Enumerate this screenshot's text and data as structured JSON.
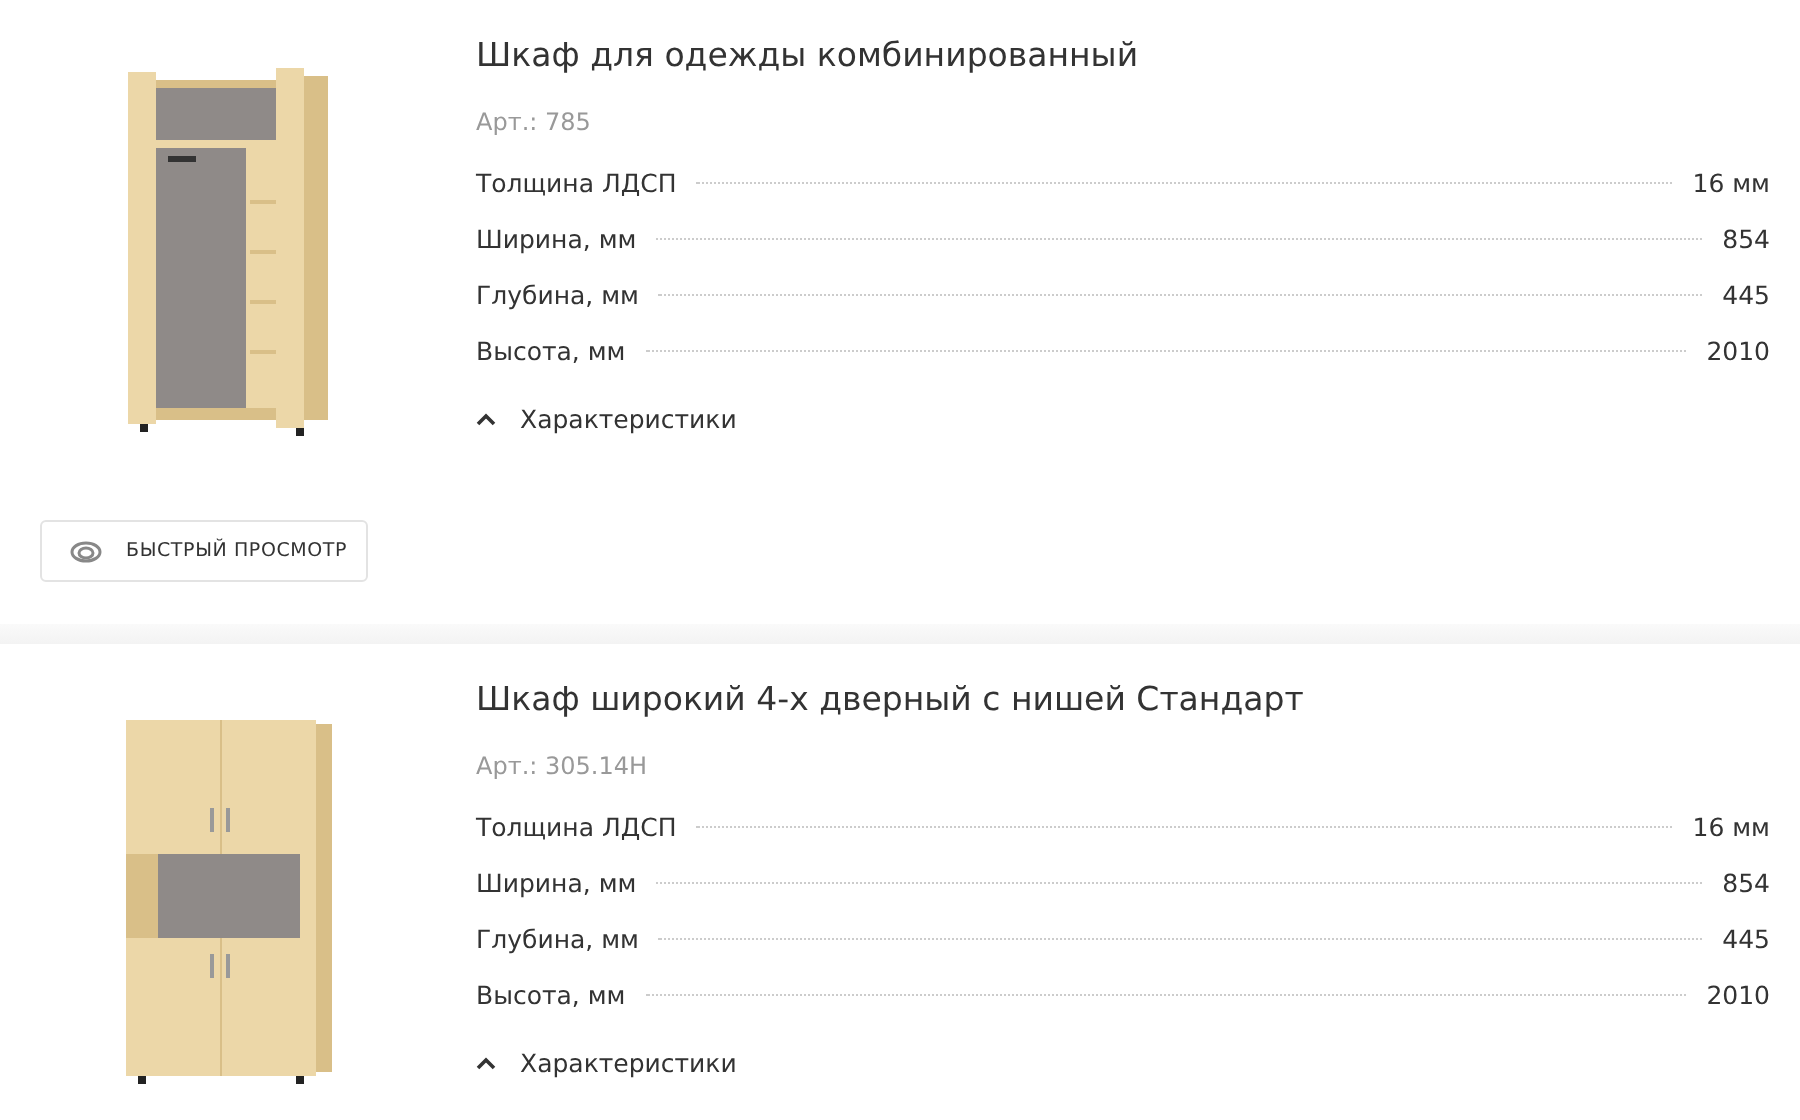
{
  "products": [
    {
      "title": "Шкаф для одежды комбинированный",
      "article": "Арт.: 785",
      "specs": [
        {
          "name": "Толщина ЛДСП",
          "value": "16 мм"
        },
        {
          "name": "Ширина, мм",
          "value": "854"
        },
        {
          "name": "Глубина, мм",
          "value": "445"
        },
        {
          "name": "Высота, мм",
          "value": "2010"
        }
      ],
      "toggle": {
        "label": "Характеристики",
        "expanded": true
      },
      "quick_view": "БЫСТРЫЙ ПРОСМОТР"
    },
    {
      "title": "Шкаф широкий 4-х дверный с нишей Стандарт",
      "article": "Арт.: 305.14Н",
      "specs": [
        {
          "name": "Толщина ЛДСП",
          "value": "16 мм"
        },
        {
          "name": "Ширина, мм",
          "value": "854"
        },
        {
          "name": "Глубина, мм",
          "value": "445"
        },
        {
          "name": "Высота, мм",
          "value": "2010"
        }
      ],
      "toggle": {
        "label": "Характеристики",
        "expanded": true
      }
    }
  ]
}
